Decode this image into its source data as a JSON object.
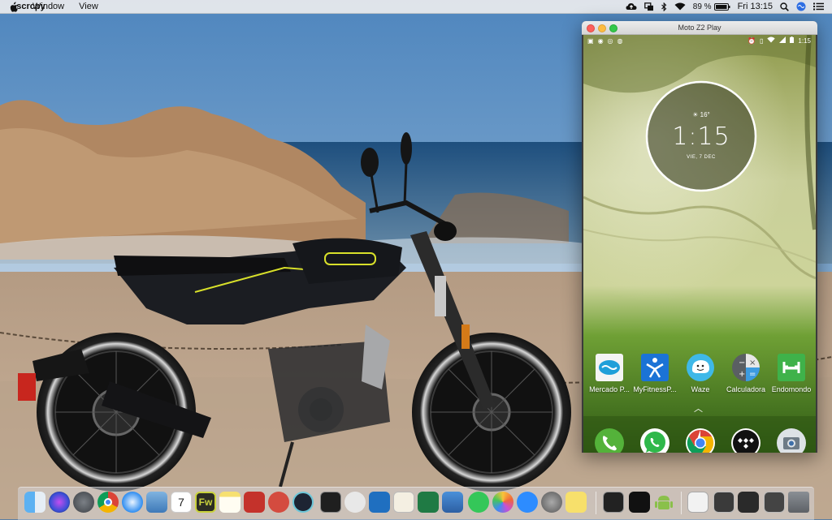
{
  "menubar": {
    "apple_icon": "apple-logo",
    "app_name": "scrcpy",
    "menus": [
      "Window",
      "View"
    ],
    "battery": "89 %",
    "clock": "Fri 13:15"
  },
  "phone_window": {
    "title": "Moto Z2 Play",
    "status_time": "1:15",
    "clock_widget": {
      "weather": "16°",
      "time": "1:15",
      "date": "VIE, 7 DEC"
    },
    "apps": [
      {
        "label": "Mercado P..."
      },
      {
        "label": "MyFitnessP..."
      },
      {
        "label": "Waze"
      },
      {
        "label": "Calculadora"
      },
      {
        "label": "Endomondo"
      }
    ],
    "hotseat": [
      "phone-icon",
      "whatsapp-icon",
      "chrome-icon",
      "tidal-icon",
      "camera-icon"
    ],
    "accent": "#6f9a32"
  },
  "dock": {
    "items": [
      "finder-icon",
      "siri-icon",
      "launchpad-icon",
      "chrome-icon",
      "safari-icon",
      "preview-icon",
      "calendar-icon",
      "fireworks-icon",
      "notes-icon",
      "filezilla-icon",
      "cisco-icon",
      "gitkraken-icon",
      "terminal-icon",
      "sequel-pro-icon",
      "vscode-icon",
      "textedit-icon",
      "excel-icon",
      "keynote-icon",
      "messages-icon",
      "photos-icon",
      "zoom-icon",
      "system-preferences-icon",
      "stickies-icon",
      "activity-monitor-icon",
      "tidal-icon",
      "android-icon",
      "document-icon",
      "display-icon",
      "screenshot-icon",
      "trash-icon"
    ],
    "calendar_day": "7",
    "fireworks_label": "Fw"
  }
}
